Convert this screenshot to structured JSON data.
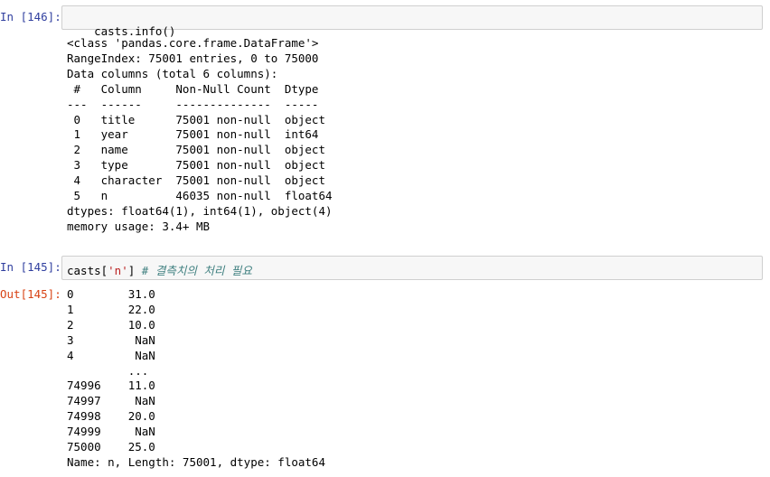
{
  "cells": [
    {
      "prompt": "In [146]:",
      "code": "casts.info()",
      "output_lines": [
        "<class 'pandas.core.frame.DataFrame'>",
        "RangeIndex: 75001 entries, 0 to 75000",
        "Data columns (total 6 columns):",
        " #   Column     Non-Null Count  Dtype  ",
        "---  ------     --------------  -----  ",
        " 0   title      75001 non-null  object ",
        " 1   year       75001 non-null  int64  ",
        " 2   name       75001 non-null  object ",
        " 3   type       75001 non-null  object ",
        " 4   character  75001 non-null  object ",
        " 5   n          46035 non-null  float64",
        "dtypes: float64(1), int64(1), object(4)",
        "memory usage: 3.4+ MB"
      ]
    },
    {
      "prompt": "In [145]:",
      "code_prefix": "casts[",
      "code_string": "'n'",
      "code_mid": "] ",
      "code_comment": "# 결측치의 처리 필요",
      "out_prompt": "Out[145]:",
      "output_lines": [
        "0        31.0",
        "1        22.0",
        "2        10.0",
        "3         NaN",
        "4         NaN",
        "         ... ",
        "74996    11.0",
        "74997     NaN",
        "74998    20.0",
        "74999     NaN",
        "75000    25.0",
        "Name: n, Length: 75001, dtype: float64"
      ]
    }
  ]
}
